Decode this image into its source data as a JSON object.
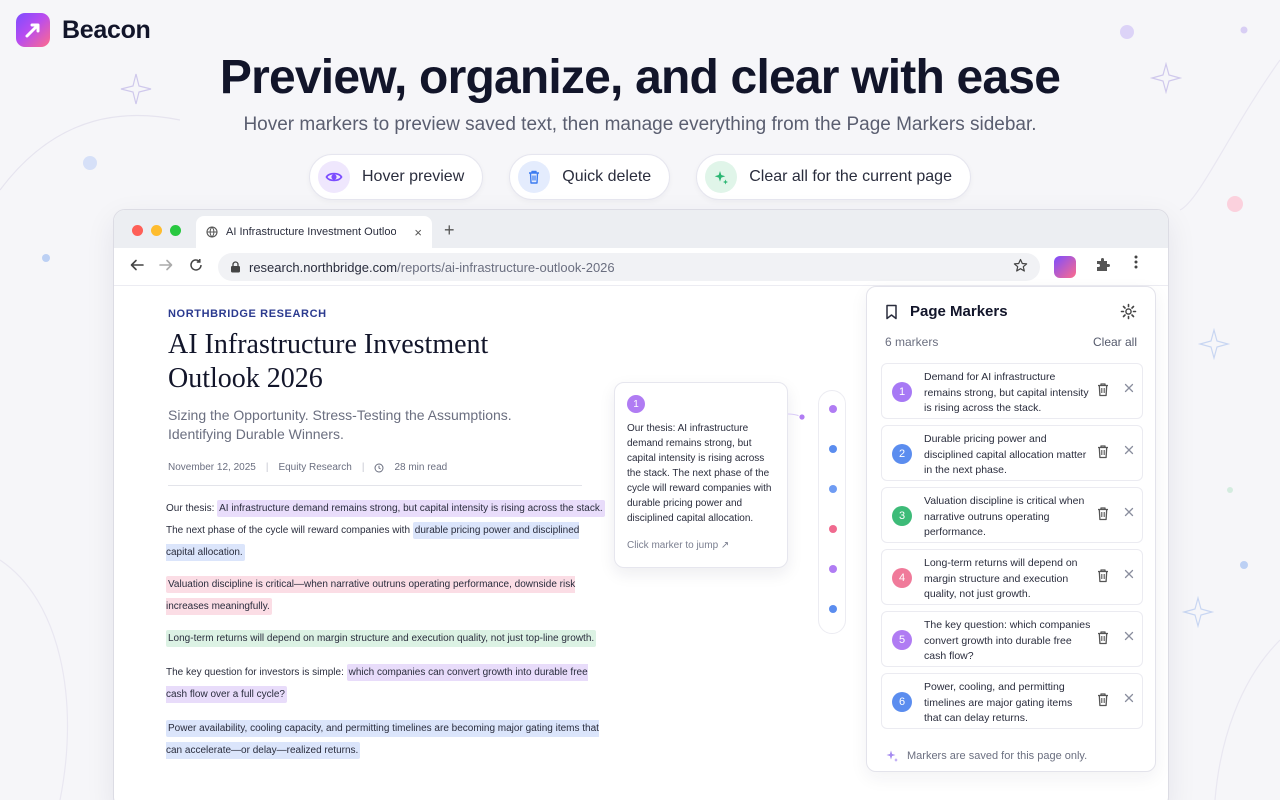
{
  "brand": {
    "name": "Beacon"
  },
  "hero": {
    "title": "Preview, organize, and clear with ease",
    "subtitle": "Hover markers to preview saved text, then manage everything from the Page Markers sidebar."
  },
  "features": [
    {
      "label": "Hover preview",
      "icon": "eye-icon",
      "color": "#7c4dff"
    },
    {
      "label": "Quick delete",
      "icon": "trash-icon",
      "color": "#3b7bf0"
    },
    {
      "label": "Clear all for the current page",
      "icon": "sparkle-icon",
      "color": "#2bb673"
    }
  ],
  "browser": {
    "tab_title": "AI Infrastructure Investment Outlook",
    "tab_close": "×",
    "new_tab": "+",
    "url_host": "research.northbridge.com",
    "url_path": "/reports/ai-infrastructure-outlook-2026"
  },
  "article": {
    "kicker": "NORTHBRIDGE RESEARCH",
    "title": "AI Infrastructure Investment Outlook 2026",
    "subtitle": "Sizing the Opportunity. Stress-Testing the Assumptions. Identifying Durable Winners.",
    "date": "November 12, 2025",
    "category": "Equity Research",
    "read_time": "28 min read",
    "p1_a": "Our thesis: ",
    "p1_hl": "AI infrastructure demand remains strong, but capital intensity is rising across the stack.",
    "p1_b": " The next phase of the cycle will reward companies with ",
    "p1_hl2": "durable pricing power and disciplined capital allocation.",
    "p2_hl": "Valuation discipline is critical—when narrative outruns operating performance, downside risk increases meaningfully.",
    "p3_hl": "Long-term returns will depend on margin structure and execution quality, not just top-line growth.",
    "p4_a": "The key question for investors is simple: ",
    "p4_hl": "which companies can convert growth into durable free cash flow over a full cycle?",
    "p5_hl": "Power availability, cooling capacity, and permitting timelines are becoming major gating items that can accelerate—or delay—realized returns."
  },
  "preview": {
    "number": "1",
    "text": "Our thesis: AI infrastructure demand remains strong, but capital intensity is rising across the stack. The next phase of the cycle will reward companies with durable pricing power and disciplined capital allocation.",
    "jump": "Click marker to jump ↗"
  },
  "sidebar": {
    "title": "Page Markers",
    "count": "6 markers",
    "clear_all": "Clear all",
    "footer": "Markers are saved for this page only.",
    "markers": [
      {
        "num": "1",
        "text": "Demand for AI infrastructure remains strong, but capital intensity is rising across the stack.",
        "color": "#a779f5"
      },
      {
        "num": "2",
        "text": "Durable pricing power and disciplined capital allocation matter in the next phase.",
        "color": "#5b8def"
      },
      {
        "num": "3",
        "text": "Valuation discipline is critical when narrative outruns operating performance.",
        "color": "#3dbb78"
      },
      {
        "num": "4",
        "text": "Long-term returns will depend on margin structure and execution quality, not just growth.",
        "color": "#f07a9a"
      },
      {
        "num": "5",
        "text": "The key question: which companies convert growth into durable free cash flow?",
        "color": "#b07cf3"
      },
      {
        "num": "6",
        "text": "Power, cooling, and permitting timelines are major gating items that can delay returns.",
        "color": "#5b8def"
      }
    ]
  },
  "rail_colors": [
    "#b07cf3",
    "#5b8def",
    "#6f9cf3",
    "#f06a8f",
    "#b07cf3",
    "#5b8def"
  ]
}
